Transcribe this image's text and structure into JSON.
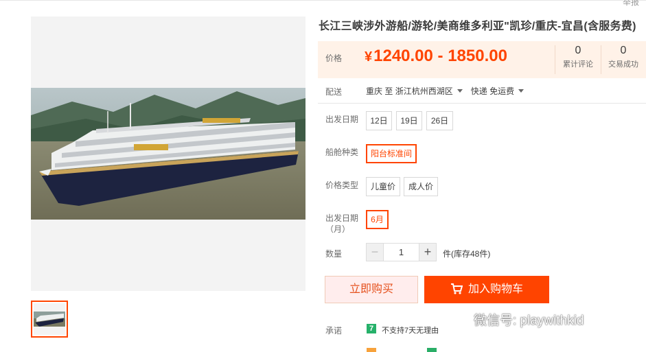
{
  "header": {
    "report_link": "举报"
  },
  "product": {
    "title": "长江三峡涉外游船/游轮/美商维多利亚\"凯珍/重庆-宜昌(含服务费)",
    "price_label": "价格",
    "currency_symbol": "¥",
    "price_range": "1240.00 - 1850.00",
    "reviews_count": "0",
    "reviews_label": "累计评论",
    "deals_count": "0",
    "deals_label": "交易成功"
  },
  "shipping": {
    "label": "配送",
    "from": "重庆",
    "to_word": "至",
    "destination": "浙江杭州西湖区",
    "method": "快递 免运费"
  },
  "options": {
    "departure_date": {
      "label": "出发日期",
      "values": [
        "12日",
        "19日",
        "26日"
      ]
    },
    "cabin_type": {
      "label": "船舱种类",
      "values": [
        "阳台标准间"
      ],
      "selected": "阳台标准间"
    },
    "price_type": {
      "label": "价格类型",
      "values": [
        "儿童价",
        "成人价"
      ]
    },
    "departure_month": {
      "label_line1": "出发日期",
      "label_line2": "（月）",
      "values": [
        "6月"
      ],
      "selected": "6月"
    }
  },
  "quantity": {
    "label": "数量",
    "minus": "−",
    "value": "1",
    "plus": "+",
    "stock_text": "件(库存48件)"
  },
  "actions": {
    "buy_now": "立即购买",
    "add_to_cart": "加入购物车"
  },
  "promise": {
    "label": "承诺",
    "icon_text": "7",
    "text": "不支持7天无理由"
  },
  "watermark": {
    "text": "微信号: playwithkid"
  },
  "colors": {
    "accent": "#ff4400",
    "price_bg": "#fff2e8",
    "promise_green": "#26b16a"
  }
}
